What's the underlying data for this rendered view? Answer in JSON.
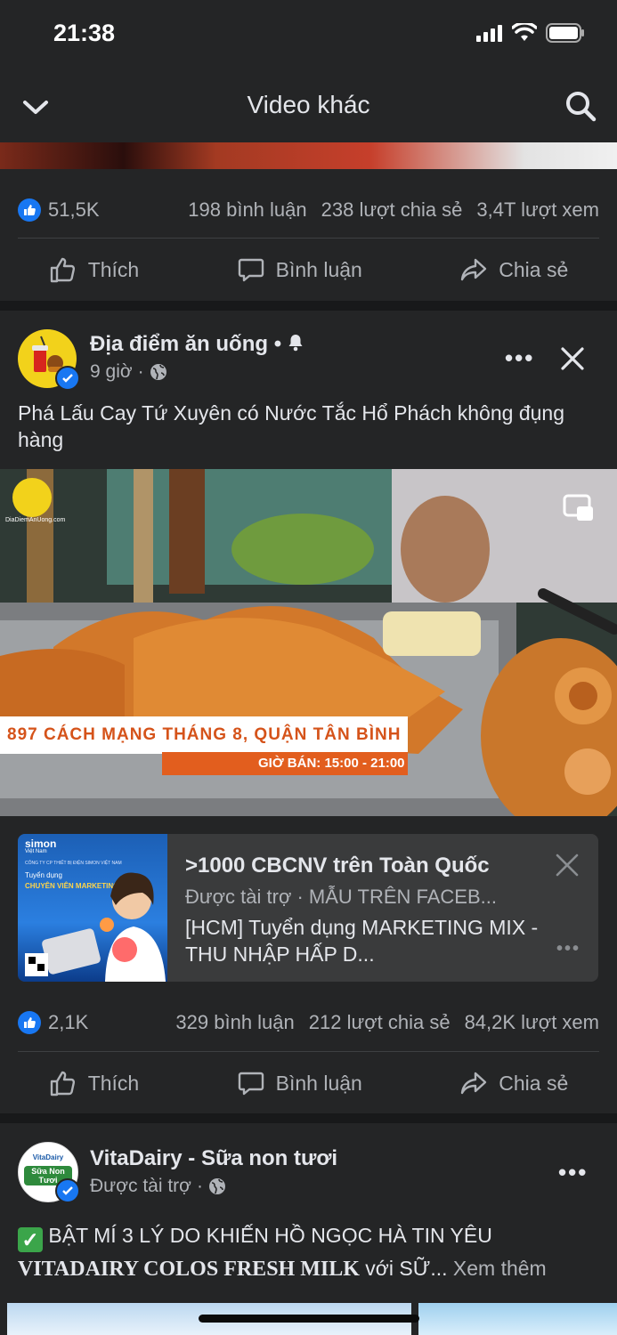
{
  "status_bar": {
    "time": "21:38"
  },
  "header": {
    "title": "Video khác",
    "back_icon": "chevron-down-icon",
    "search_icon": "search-icon"
  },
  "post1": {
    "stats": {
      "likes": "51,5K",
      "comments": "198 bình luận",
      "shares": "238 lượt chia sẻ",
      "views": "3,4T lượt xem"
    },
    "actions": {
      "like": "Thích",
      "comment": "Bình luận",
      "share": "Chia sẻ"
    }
  },
  "post2": {
    "page_name": "Địa điểm ăn uống",
    "time": "9 giờ",
    "text": "Phá Lấu Cay Tứ Xuyên có Nước Tắc Hổ Phách không đụng hàng",
    "video": {
      "watermark": "DiaDiemAnUong.com",
      "address": "897 CÁCH MẠNG THÁNG 8, QUẬN TÂN BÌNH",
      "hours": "GIỜ BÁN: 15:00 - 21:00"
    },
    "ad": {
      "title": ">1000 CBCNV trên Toàn Quốc",
      "sponsor": "Được tài trợ · MẪU TRÊN FACEB...",
      "desc": "[HCM] Tuyển dụng MARKETING MIX - THU NHẬP HẤP D...",
      "img_brand": "simon",
      "img_brand_sub": "Việt Nam",
      "img_line1": "CÔNG TY CP THIẾT BỊ ĐIỆN SIMON VIỆT NAM",
      "img_line2": "Tuyển dụng",
      "img_line3": "CHUYÊN VIÊN MARKETING"
    },
    "stats": {
      "likes": "2,1K",
      "comments": "329 bình luận",
      "shares": "212 lượt chia sẻ",
      "views": "84,2K lượt xem"
    },
    "actions": {
      "like": "Thích",
      "comment": "Bình luận",
      "share": "Chia sẻ"
    }
  },
  "post3": {
    "page_name": "VitaDairy - Sữa non tươi",
    "meta": "Được tài trợ",
    "avatar_text": "Sữa Non Tươi",
    "avatar_brand": "VitaDairy",
    "text_prefix": "BẬT MÍ 3 LÝ DO KHIẾN HỒ NGỌC HÀ TIN YÊU",
    "text_bold": "VITADAIRY COLOS FRESH MILK",
    "text_suffix": " với SỮ...",
    "see_more": "Xem thêm"
  }
}
